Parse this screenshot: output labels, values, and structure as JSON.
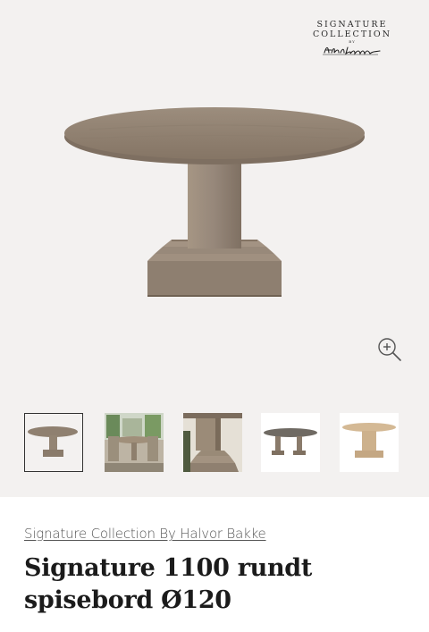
{
  "brand_logo": {
    "line1": "SIGNATURE",
    "line2": "COLLECTION",
    "by": "BY",
    "signature": "Halvor Bakke"
  },
  "gallery": {
    "background": "#f3f1f0",
    "zoom_icon": "zoom-in-icon",
    "thumbnails": [
      {
        "label": "table-front",
        "active": true
      },
      {
        "label": "dining-room-scene",
        "active": false
      },
      {
        "label": "base-closeup",
        "active": false
      },
      {
        "label": "table-dark-top",
        "active": false
      },
      {
        "label": "table-light-oak",
        "active": false
      }
    ]
  },
  "product": {
    "brand_link": "Signature Collection By Halvor Bakke",
    "title": "Signature 1100 rundt spisebord Ø120"
  },
  "colors": {
    "wood": "#8f8070",
    "wood_dark": "#7a6b5c",
    "text": "#1b1b1b",
    "link": "#555555"
  }
}
